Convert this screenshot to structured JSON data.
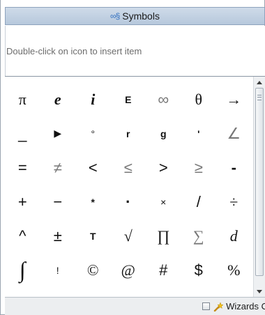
{
  "panel": {
    "title": "Symbols",
    "title_icon": "infinity-symbol-icon",
    "hint": "Double-click on icon to insert item"
  },
  "symbols": [
    {
      "glyph": "π",
      "name": "pi"
    },
    {
      "glyph": "e",
      "name": "euler-e"
    },
    {
      "glyph": "i",
      "name": "imaginary-i"
    },
    {
      "glyph": "E",
      "name": "exponent-e"
    },
    {
      "glyph": "∞",
      "name": "infinity"
    },
    {
      "glyph": "θ",
      "name": "theta"
    },
    {
      "glyph": "→",
      "name": "right-arrow"
    },
    {
      "glyph": "_",
      "name": "underscore"
    },
    {
      "glyph": "▶",
      "name": "right-triangle"
    },
    {
      "glyph": "°",
      "name": "degree"
    },
    {
      "glyph": "r",
      "name": "radians"
    },
    {
      "glyph": "g",
      "name": "gradians"
    },
    {
      "glyph": "'",
      "name": "prime"
    },
    {
      "glyph": "∠",
      "name": "angle"
    },
    {
      "glyph": "=",
      "name": "equals"
    },
    {
      "glyph": "≠",
      "name": "not-equal"
    },
    {
      "glyph": "<",
      "name": "less-than"
    },
    {
      "glyph": "≤",
      "name": "less-equal"
    },
    {
      "glyph": ">",
      "name": "greater-than"
    },
    {
      "glyph": "≥",
      "name": "greater-equal"
    },
    {
      "glyph": "-",
      "name": "hyphen"
    },
    {
      "glyph": "+",
      "name": "plus"
    },
    {
      "glyph": "−",
      "name": "minus"
    },
    {
      "glyph": "*",
      "name": "asterisk"
    },
    {
      "glyph": "·",
      "name": "dot"
    },
    {
      "glyph": "×",
      "name": "times"
    },
    {
      "glyph": "/",
      "name": "slash"
    },
    {
      "glyph": "÷",
      "name": "divide"
    },
    {
      "glyph": "^",
      "name": "caret"
    },
    {
      "glyph": "±",
      "name": "plus-minus"
    },
    {
      "glyph": "T",
      "name": "transpose"
    },
    {
      "glyph": "√",
      "name": "square-root"
    },
    {
      "glyph": "∏",
      "name": "product"
    },
    {
      "glyph": "∑",
      "name": "summation"
    },
    {
      "glyph": "d",
      "name": "differential"
    },
    {
      "glyph": "∫",
      "name": "integral"
    },
    {
      "glyph": "!",
      "name": "factorial"
    },
    {
      "glyph": "©",
      "name": "copyright"
    },
    {
      "glyph": "@",
      "name": "at-sign"
    },
    {
      "glyph": "#",
      "name": "hash"
    },
    {
      "glyph": "$",
      "name": "dollar"
    },
    {
      "glyph": "%",
      "name": "percent"
    },
    {
      "glyph": "&",
      "name": "ampersand"
    },
    {
      "glyph": "|",
      "name": "pipe"
    },
    {
      "glyph": "\"",
      "name": "double-quote"
    },
    {
      "glyph": "",
      "name": "empty"
    },
    {
      "glyph": "",
      "name": "empty"
    },
    {
      "glyph": "",
      "name": "empty"
    },
    {
      "glyph": "",
      "name": "empty"
    }
  ],
  "scrollbar": {
    "up_icon": "arrow-up-icon",
    "down_icon": "arrow-down-icon"
  },
  "bottom": {
    "wizards_label": "Wizards On",
    "wizards_icon": "magic-wand-icon",
    "checked": false
  },
  "colors": {
    "title_bg": "#c3d2e4",
    "title_icon": "#2f6fc0",
    "hint_text": "#6c6c6c"
  }
}
